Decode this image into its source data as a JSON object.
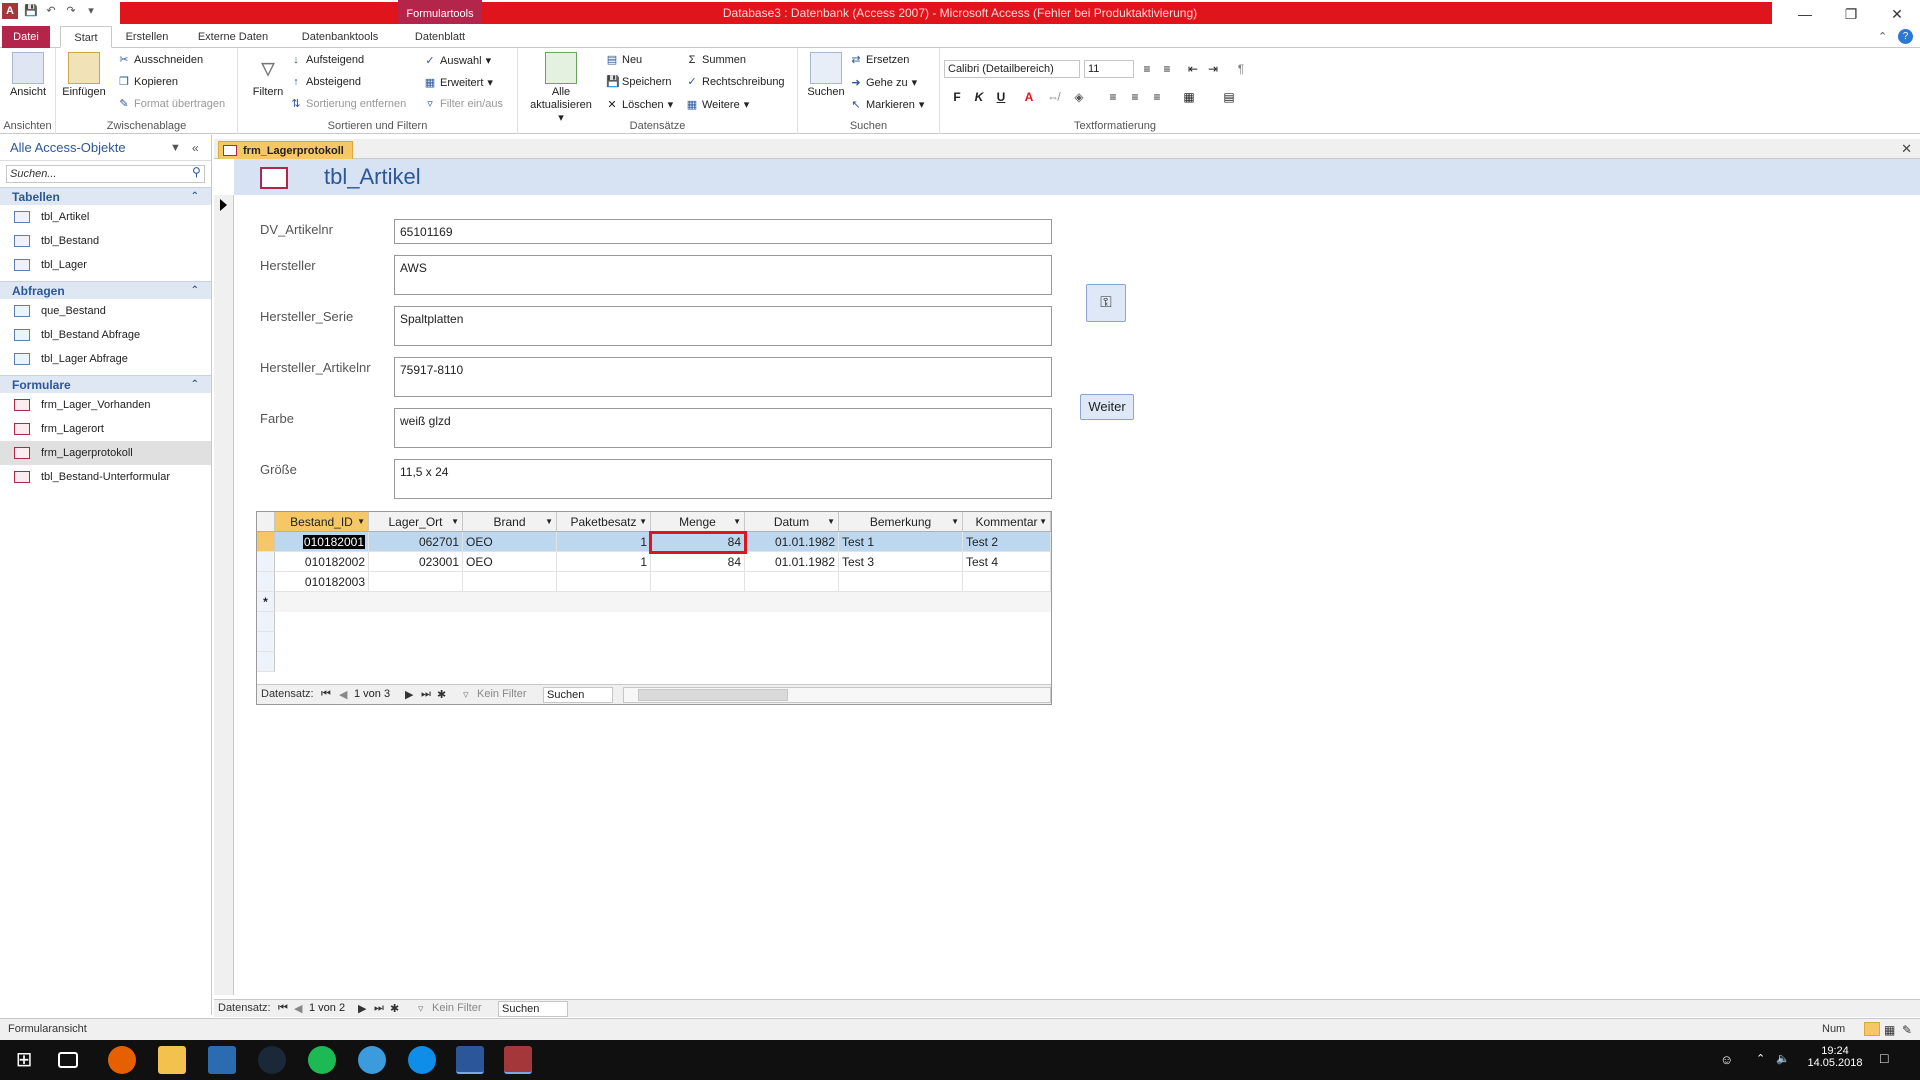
{
  "window": {
    "title": "Database3 : Datenbank (Access 2007) - Microsoft Access (Fehler bei Produktaktivierung)",
    "contextual_tab": "Formulartools"
  },
  "ribbon_tabs": [
    "Datei",
    "Start",
    "Erstellen",
    "Externe Daten",
    "Datenbanktools",
    "Datenblatt"
  ],
  "ribbon": {
    "ansicht": "Ansicht",
    "einfuegen": "Einfügen",
    "ausschneiden": "Ausschneiden",
    "kopieren": "Kopieren",
    "format_uebertragen": "Format übertragen",
    "filtern": "Filtern",
    "aufsteigend": "Aufsteigend",
    "absteigend": "Absteigend",
    "sortierung_entfernen": "Sortierung entfernen",
    "auswahl": "Auswahl",
    "erweitert": "Erweitert",
    "filter_ein_aus": "Filter ein/aus",
    "alle_aktualisieren_1": "Alle",
    "alle_aktualisieren_2": "aktualisieren",
    "neu": "Neu",
    "speichern": "Speichern",
    "loeschen": "Löschen",
    "summen": "Summen",
    "rechtschreibung": "Rechtschreibung",
    "weitere": "Weitere",
    "suchen": "Suchen",
    "ersetzen": "Ersetzen",
    "gehe_zu": "Gehe zu",
    "markieren": "Markieren",
    "font_name": "Calibri (Detailbereich)",
    "font_size": "11",
    "groups": {
      "ansichten": "Ansichten",
      "zwischenablage": "Zwischenablage",
      "sortieren": "Sortieren und Filtern",
      "datensaetze": "Datensätze",
      "suchen": "Suchen",
      "textformatierung": "Textformatierung"
    }
  },
  "nav_pane": {
    "header": "Alle Access-Objekte",
    "search_placeholder": "Suchen...",
    "sections": [
      {
        "title": "Tabellen",
        "items": [
          "tbl_Artikel",
          "tbl_Bestand",
          "tbl_Lager"
        ]
      },
      {
        "title": "Abfragen",
        "items": [
          "que_Bestand",
          "tbl_Bestand Abfrage",
          "tbl_Lager Abfrage"
        ]
      },
      {
        "title": "Formulare",
        "items": [
          "frm_Lager_Vorhanden",
          "frm_Lagerort",
          "frm_Lagerprotokoll",
          "tbl_Bestand-Unterformular"
        ]
      }
    ]
  },
  "document": {
    "tab": "frm_Lagerprotokoll",
    "form_title": "tbl_Artikel"
  },
  "fields": [
    {
      "label": "DV_Artikelnr",
      "value": "65101169"
    },
    {
      "label": "Hersteller",
      "value": "AWS"
    },
    {
      "label": "Hersteller_Serie",
      "value": "Spaltplatten"
    },
    {
      "label": "Hersteller_Artikelnr",
      "value": "75917-8110"
    },
    {
      "label": "Farbe",
      "value": "weiß glzd"
    },
    {
      "label": "Größe",
      "value": "11,5 x 24"
    }
  ],
  "weiter_label": "Weiter",
  "subform": {
    "columns": [
      "Bestand_ID",
      "Lager_Ort",
      "Brand",
      "Paketbesatz",
      "Menge",
      "Datum",
      "Bemerkung",
      "Kommentar"
    ],
    "rows": [
      [
        "010182001",
        "062701",
        "OEO",
        "1",
        "84",
        "01.01.1982",
        "Test 1",
        "Test 2"
      ],
      [
        "010182002",
        "023001",
        "OEO",
        "1",
        "84",
        "01.01.1982",
        "Test 3",
        "Test 4"
      ],
      [
        "010182003",
        "",
        "",
        "",
        "",
        "",
        "",
        ""
      ]
    ],
    "nav": {
      "label": "Datensatz:",
      "position": "1 von 3",
      "filter": "Kein Filter",
      "search": "Suchen"
    }
  },
  "main_nav": {
    "label": "Datensatz:",
    "position": "1 von 2",
    "filter": "Kein Filter",
    "search": "Suchen"
  },
  "status": {
    "left": "Formularansicht",
    "num": "Num"
  },
  "taskbar": {
    "time": "19:24",
    "date": "14.05.2018"
  }
}
